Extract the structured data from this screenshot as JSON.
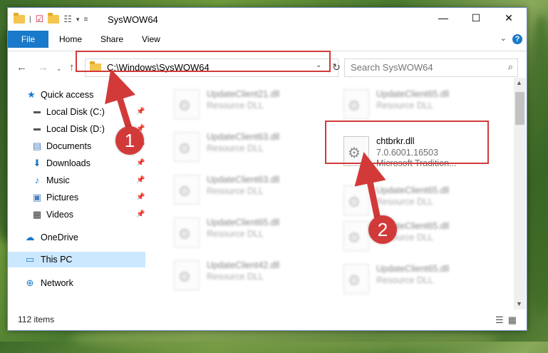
{
  "window": {
    "title": "SysWOW64",
    "minimize": "—",
    "maximize": "☐",
    "close": "✕"
  },
  "ribbon": {
    "tabs": [
      "File",
      "Home",
      "Share",
      "View"
    ],
    "help": "?"
  },
  "address": {
    "path": "C:\\Windows\\SysWOW64",
    "refresh": "↻"
  },
  "search": {
    "placeholder": "Search SysWOW64"
  },
  "sidebar": {
    "items": [
      {
        "label": "Quick access"
      },
      {
        "label": "Local Disk (C:)"
      },
      {
        "label": "Local Disk (D:)"
      },
      {
        "label": "Documents"
      },
      {
        "label": "Downloads"
      },
      {
        "label": "Music"
      },
      {
        "label": "Pictures"
      },
      {
        "label": "Videos"
      },
      {
        "label": "OneDrive"
      },
      {
        "label": "This PC"
      },
      {
        "label": "Network"
      }
    ]
  },
  "files": {
    "left": [
      {
        "name": "UpdateClient21.dll",
        "desc": "Resource DLL"
      },
      {
        "name": "UpdateClient63.dll",
        "desc": "Resource DLL"
      },
      {
        "name": "UpdateClient63.dll",
        "desc": "Resource DLL"
      },
      {
        "name": "UpdateClient65.dll",
        "desc": "Resource DLL"
      },
      {
        "name": "UpdateClient42.dll",
        "desc": "Resource DLL"
      }
    ],
    "right": [
      {
        "name": "UpdateClient65.dll",
        "desc": "Resource DLL"
      },
      {
        "name": "UpdateClient65.dll",
        "desc": "Resource DLL"
      },
      {
        "name": "UpdateClient65.dll",
        "desc": "Resource DLL"
      },
      {
        "name": "UpdateClient65.dll",
        "desc": "Resource DLL"
      }
    ],
    "highlighted": {
      "name": "chtbrkr.dll",
      "version": "7.0.6001.16503",
      "company": "Microsoft Tradition..."
    }
  },
  "status": {
    "count": "112 items"
  },
  "annotations": {
    "step1": "1",
    "step2": "2",
    "color": "#d23a3a"
  }
}
